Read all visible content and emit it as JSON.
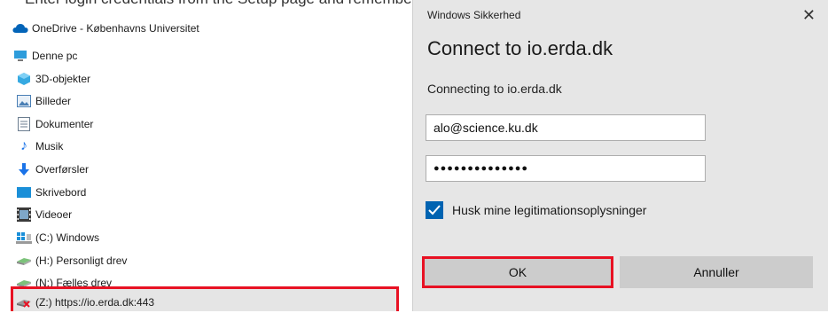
{
  "top_strip_text": "Enter login credentials from the Setup page and remember to toggle the Remember credentials box",
  "nav": {
    "onedrive": "OneDrive - Københavns Universitet",
    "this_pc": "Denne pc",
    "items": [
      {
        "label": "3D-objekter",
        "icon": "3d-objects-icon"
      },
      {
        "label": "Billeder",
        "icon": "pictures-icon"
      },
      {
        "label": "Dokumenter",
        "icon": "documents-icon"
      },
      {
        "label": "Musik",
        "icon": "music-icon"
      },
      {
        "label": "Overførsler",
        "icon": "downloads-icon"
      },
      {
        "label": "Skrivebord",
        "icon": "desktop-icon"
      },
      {
        "label": "Videoer",
        "icon": "videos-icon"
      },
      {
        "label": "(C:) Windows",
        "icon": "windows-drive-icon"
      },
      {
        "label": "(H:) Personligt drev",
        "icon": "network-drive-icon"
      },
      {
        "label": "(N:) Fælles drev",
        "icon": "network-drive-icon"
      },
      {
        "label": "(Z:) https://io.erda.dk:443",
        "icon": "disconnected-drive-icon"
      }
    ]
  },
  "dialog": {
    "caption": "Windows Sikkerhed",
    "close": "✕",
    "title": "Connect to io.erda.dk",
    "subtitle": "Connecting to io.erda.dk",
    "username": "alo@science.ku.dk",
    "password_mask": "●●●●●●●●●●●●●●",
    "remember_label": "Husk mine legitimationsoplysninger",
    "remember_checked": true,
    "ok_label": "OK",
    "cancel_label": "Annuller"
  },
  "colors": {
    "highlight": "#e81123",
    "checkbox": "#0063b1",
    "dialog_bg": "#e6e6e6"
  }
}
